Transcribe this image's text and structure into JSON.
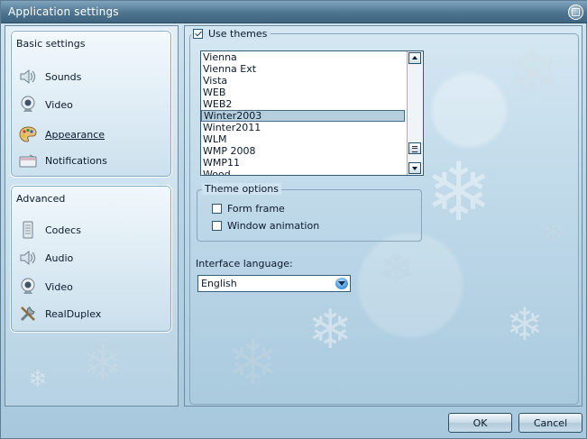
{
  "window": {
    "title": "Application settings"
  },
  "sidebar": {
    "basic": {
      "title": "Basic settings",
      "items": [
        {
          "label": "Sounds",
          "icon": "speaker-icon"
        },
        {
          "label": "Video",
          "icon": "webcam-icon"
        },
        {
          "label": "Appearance",
          "icon": "palette-icon",
          "active": true
        },
        {
          "label": "Notifications",
          "icon": "notification-icon"
        }
      ]
    },
    "advanced": {
      "title": "Advanced",
      "items": [
        {
          "label": "Codecs",
          "icon": "codec-icon"
        },
        {
          "label": "Audio",
          "icon": "speaker-icon"
        },
        {
          "label": "Video",
          "icon": "webcam-icon"
        },
        {
          "label": "RealDuplex",
          "icon": "tools-icon"
        }
      ]
    }
  },
  "appearance": {
    "use_themes_label": "Use themes",
    "use_themes_checked": true,
    "themes": [
      "Vienna",
      "Vienna Ext",
      "Vista",
      "WEB",
      "WEB2",
      "Winter2003",
      "Winter2011",
      "WLM",
      "WMP 2008",
      "WMP11",
      "Wood"
    ],
    "selected_theme": "Winter2003",
    "theme_options": {
      "title": "Theme options",
      "form_frame_label": "Form frame",
      "form_frame_checked": false,
      "window_animation_label": "Window animation",
      "window_animation_checked": false
    },
    "language_label": "Interface language:",
    "language_value": "English"
  },
  "footer": {
    "ok_label": "OK",
    "cancel_label": "Cancel"
  },
  "colors": {
    "titlebar": "#4e7590",
    "selection": "#b6cfdf",
    "background": "#b9d6e7"
  }
}
